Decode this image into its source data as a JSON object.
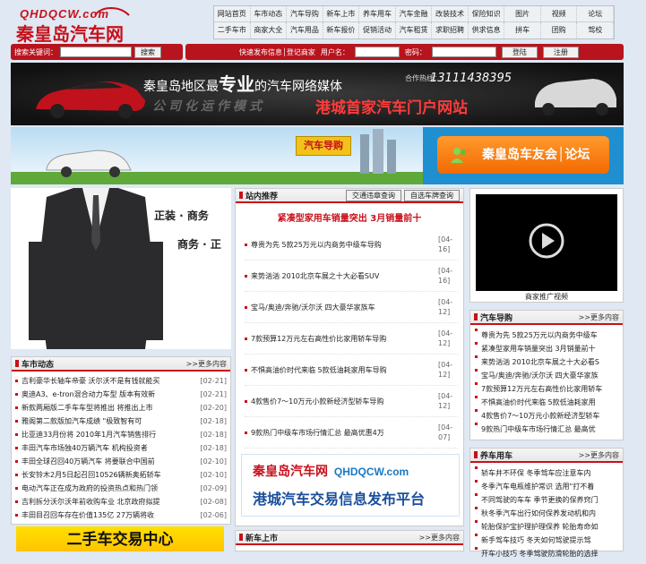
{
  "logo": {
    "en": "QHDQCW.com",
    "cn": "秦皇岛汽车网"
  },
  "nav": {
    "row1": [
      "网站首页",
      "车市动态",
      "汽车导购",
      "新车上市",
      "养车用车",
      "汽车金融",
      "改装技术",
      "保险知识",
      "图片",
      "视频",
      "论坛"
    ],
    "row2": [
      "二手车市",
      "商家大全",
      "汽车用品",
      "新车报价",
      "促销活动",
      "汽车租赁",
      "求职招聘",
      "供求信息",
      "拼车",
      "团购",
      "驾校"
    ]
  },
  "searchbar": {
    "label": "搜索关键词：",
    "button": "搜索",
    "quick": "快速发布信息│登记商家",
    "username_label": "用户名：",
    "password_label": "密码：",
    "login": "登陆",
    "register": "注册"
  },
  "banner1": {
    "line1a": "秦皇岛地区最",
    "line1b": "专业",
    "line1c": "的汽车网络媒体",
    "coop_label": "合作热线：",
    "phone": "13111438395",
    "slogan": "公司化运作模式",
    "tagline": "港城首家汽车门户网站"
  },
  "banner2": {
    "sign": "汽车导购",
    "club": "秦皇岛车友会│论坛"
  },
  "left_ad": {
    "t1": "正装 · 商务",
    "t2": "商务 · 正"
  },
  "news": {
    "title": "车市动态",
    "more": ">>更多内容",
    "items": [
      {
        "t": "吉利豪华长轴车帝豪 沃尔沃不是有钱就能买",
        "d": "[02-21]"
      },
      {
        "t": "奥迪A3、e-tron混合动力车型 版本有效新",
        "d": "[02-21]"
      },
      {
        "t": "新款两厢版二手车车型将推出 将推出上市",
        "d": "[02-20]"
      },
      {
        "t": "雅阁第二款版加汽车成绩 \"极致智有可",
        "d": "[02-18]"
      },
      {
        "t": "比亚迪33月份将 2010年1月汽车销售排行",
        "d": "[02-18]"
      },
      {
        "t": "丰田汽车市场独40万辆汽车 机构投资者",
        "d": "[02-18]"
      },
      {
        "t": "丰田全球召回40万辆汽车 将要联合中国前",
        "d": "[02-10]"
      },
      {
        "t": "长安铃木2月5日起召回10526辆新奥拓轿车",
        "d": "[02-10]"
      },
      {
        "t": "电动汽车正在成为政府的投资热点和热门领",
        "d": "[02-09]"
      },
      {
        "t": "吉利拆分沃尔沃年前收购车业 北京政府拟提",
        "d": "[02-08]"
      },
      {
        "t": "丰田目召回车存在价值135亿 27万辆将收",
        "d": "[02-06]"
      }
    ]
  },
  "bottom_left_ad": "二手车交易中心",
  "featured": {
    "title": "站内推荐",
    "btn1": "交通违章查询",
    "btn2": "自选车牌查询",
    "headline": "紧凑型家用车销量突出 3月销量前十",
    "items": [
      {
        "t": "尊贵为先 5款25万元以内商务中级车导购",
        "d": "[04-16]"
      },
      {
        "t": "来势汹汹 2010北京车展之十大必看SUV",
        "d": "[04-16]"
      },
      {
        "t": "宝马/奥迪/奔驰/沃尔沃 四大豪华家族车",
        "d": "[04-12]"
      },
      {
        "t": "7款预算12万元左右高性价比家用轿车导购",
        "d": "[04-12]"
      },
      {
        "t": "不惧高油价时代来临 5款低油耗家用车导购",
        "d": "[04-12]"
      },
      {
        "t": "4款售价7～10万元小款新经济型轿车导购",
        "d": "[04-12]"
      },
      {
        "t": "9款热门中级车市场行情汇总 最高优惠4万",
        "d": "[04-07]"
      }
    ]
  },
  "brand_ad": {
    "cn": "秦皇岛汽车网",
    "en": "QHDQCW.com",
    "sub": "港城汽车交易信息发布平台"
  },
  "newcar": {
    "title": "新车上市",
    "more": ">>更多内容"
  },
  "video": {
    "caption": "商家推广视频"
  },
  "guide": {
    "title": "汽车导购",
    "more": ">>更多内容",
    "items": [
      "尊贵为先 5款25万元以内商务中级车",
      "紧凑型家用车销量突出 3月销量前十",
      "来势汹汹 2010北京车展之十大必看S",
      "宝马/奥迪/奔驰/沃尔沃 四大豪华家族",
      "7款预算12万元左右高性价比家用轿车",
      "不惧高油价时代来临 5款低油耗家用",
      "4款售价7～10万元小款新经济型轿车",
      "9款热门中级车市场行情汇总 最高优"
    ]
  },
  "care": {
    "title": "养车用车",
    "more": ">>更多内容",
    "items": [
      "轿车井不环保 冬季驾车应注意车内",
      "冬季汽车电瓶维护常识 选用\"打不着",
      "不同驾驶的车车 季节更换的保养窍门",
      "秋冬季汽车出行如何保养发动机和内",
      "轮胎保护宝护理护理保养 轮胎寿命如",
      "新手驾车技巧 冬天如何驾驶提示驾",
      "开车小技巧 冬季驾驶防滑轮胎的选择"
    ]
  },
  "colors": {
    "brand": "#c8101a",
    "bar": "#b8141d",
    "banner_red": "#ff3b3b"
  }
}
